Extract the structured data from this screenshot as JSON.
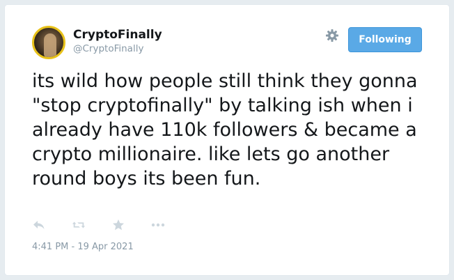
{
  "tweet": {
    "display_name": "CryptoFinally",
    "handle": "@CryptoFinally",
    "follow_button_label": "Following",
    "text": "its wild how people still think they gonna \"stop cryptofinally\" by talking ish when i already have 110k followers & became a crypto millionaire. like lets go another round boys its been fun.",
    "timestamp": "4:41 PM - 19 Apr 2021"
  },
  "icons": {
    "settings": "gear-icon",
    "reply": "reply-icon",
    "retweet": "retweet-icon",
    "like": "star-icon",
    "more": "more-icon"
  },
  "colors": {
    "follow_button": "#5aa9e6",
    "muted_text": "#8899a6",
    "icon": "#ccd6dd",
    "avatar_border": "#e8c21a"
  }
}
